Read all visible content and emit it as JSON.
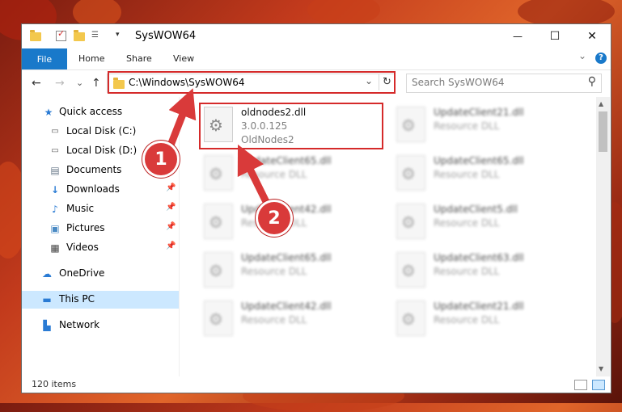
{
  "window": {
    "title": "SysWOW64",
    "minimize_glyph": "—",
    "maximize_glyph": "☐",
    "close_glyph": "✕",
    "help_glyph": "?",
    "collapse_glyph": "⌄"
  },
  "ribbon": {
    "tabs": [
      "File",
      "Home",
      "Share",
      "View"
    ]
  },
  "navbar": {
    "back_glyph": "←",
    "forward_glyph": "→",
    "recent_glyph": "⌄",
    "up_glyph": "↑",
    "address": "C:\\Windows\\SysWOW64",
    "address_dropdown_glyph": "⌄",
    "refresh_glyph": "↻",
    "search_placeholder": "Search SysWOW64",
    "search_glyph": "⚲"
  },
  "sidebar": {
    "quick_access": "Quick access",
    "items": [
      {
        "label": "Local Disk (C:)",
        "icon": "drive-icon"
      },
      {
        "label": "Local Disk (D:)",
        "icon": "drive-icon"
      },
      {
        "label": "Documents",
        "icon": "documents-icon"
      },
      {
        "label": "Downloads",
        "icon": "downloads-icon"
      },
      {
        "label": "Music",
        "icon": "music-icon"
      },
      {
        "label": "Pictures",
        "icon": "pictures-icon"
      },
      {
        "label": "Videos",
        "icon": "videos-icon"
      }
    ],
    "onedrive": "OneDrive",
    "this_pc": "This PC",
    "network": "Network"
  },
  "files": [
    {
      "name": "oldnodes2.dll",
      "line2": "3.0.0.125",
      "line3": "OldNodes2",
      "blurred": false
    },
    {
      "name": "UpdateClient21.dll",
      "line2": "Resource DLL",
      "line3": "",
      "blurred": true
    },
    {
      "name": "UpdateClient65.dll",
      "line2": "Resource DLL",
      "line3": "",
      "blurred": true
    },
    {
      "name": "UpdateClient65.dll",
      "line2": "Resource DLL",
      "line3": "",
      "blurred": true
    },
    {
      "name": "UpdateClient42.dll",
      "line2": "Resource DLL",
      "line3": "",
      "blurred": true
    },
    {
      "name": "UpdateClient5.dll",
      "line2": "Resource DLL",
      "line3": "",
      "blurred": true
    },
    {
      "name": "UpdateClient65.dll",
      "line2": "Resource DLL",
      "line3": "",
      "blurred": true
    },
    {
      "name": "UpdateClient63.dll",
      "line2": "Resource DLL",
      "line3": "",
      "blurred": true
    },
    {
      "name": "UpdateClient42.dll",
      "line2": "Resource DLL",
      "line3": "",
      "blurred": true
    },
    {
      "name": "UpdateClient21.dll",
      "line2": "Resource DLL",
      "line3": "",
      "blurred": true
    }
  ],
  "status": {
    "item_count": "120 items"
  },
  "callouts": [
    "1",
    "2"
  ],
  "colors": {
    "accent": "#1979ca",
    "highlight": "#d52a2a",
    "callout": "#d93a3a"
  }
}
